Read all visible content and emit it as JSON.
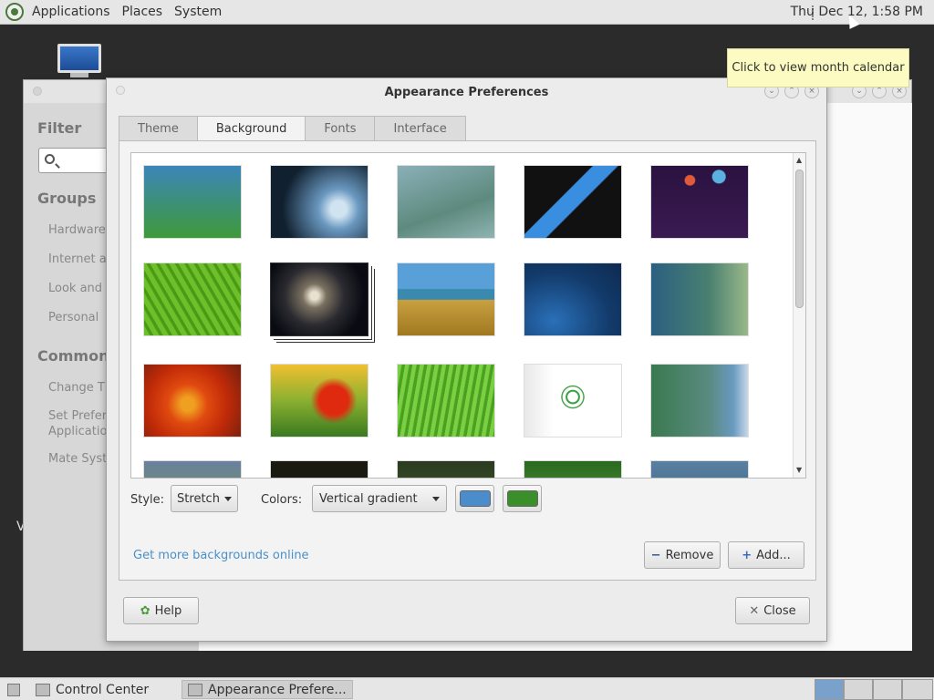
{
  "top_panel": {
    "menus": [
      "Applications",
      "Places",
      "System"
    ],
    "clock": "Thu Dec 12,  1:58 PM"
  },
  "tooltip": "Click to view month calendar",
  "control_center": {
    "filter_heading": "Filter",
    "groups_heading": "Groups",
    "groups": [
      "Hardware",
      "Internet ar",
      "Look and F",
      "Personal"
    ],
    "common_heading": "Common T",
    "common_tasks": [
      "Change Th",
      "Set Prefer",
      "Applicatio",
      "Mate Syste"
    ],
    "desktop_letter": "V"
  },
  "dialog": {
    "title": "Appearance Preferences",
    "tabs": [
      "Theme",
      "Background",
      "Fonts",
      "Interface"
    ],
    "style_label": "Style:",
    "style_value": "Stretch",
    "colors_label": "Colors:",
    "colors_value": "Vertical gradient",
    "color1": "#4a8ccc",
    "color2": "#3a8f2a",
    "more_link": "Get more backgrounds online",
    "remove_label": "Remove",
    "add_label": "Add...",
    "help_label": "Help",
    "close_label": "Close"
  },
  "taskbar": {
    "items": [
      "Control Center",
      "Appearance Prefere..."
    ]
  }
}
